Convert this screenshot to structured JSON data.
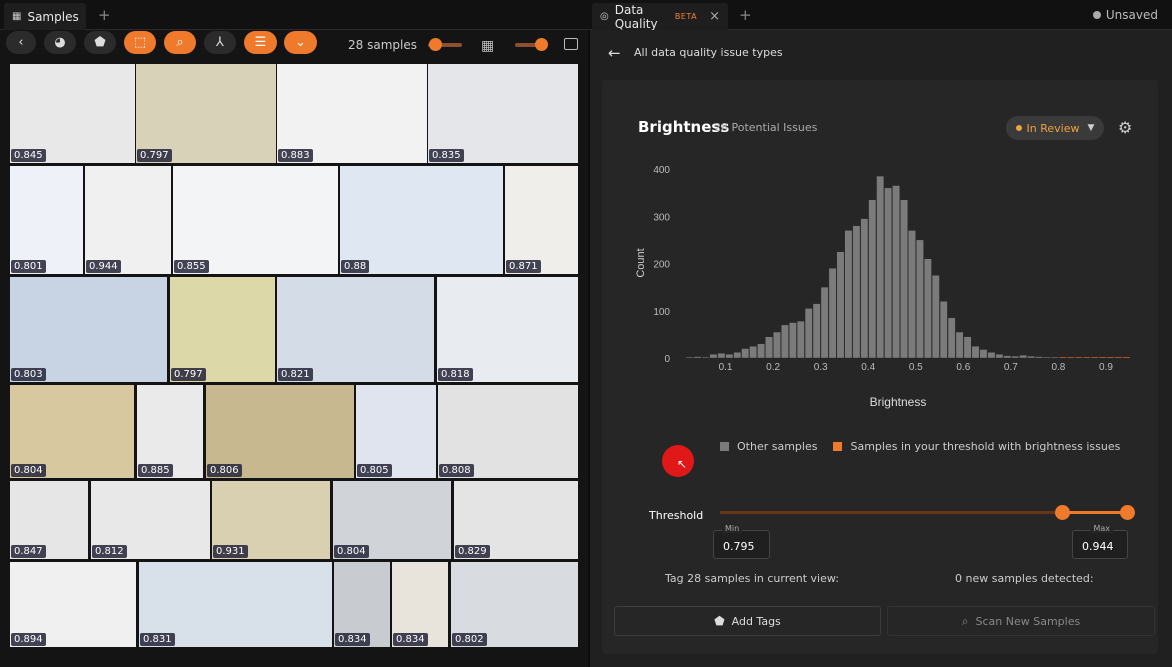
{
  "tabs": {
    "left_title": "Samples",
    "right_title": "Data Quality",
    "right_badge": "BETA",
    "plus": "+",
    "close": "×",
    "unsaved": "Unsaved"
  },
  "toolbar": {
    "sample_count": "28 samples",
    "zoom_level": 0.2,
    "size_level": 0.8,
    "icons": [
      "back-icon",
      "palette-icon",
      "tag-icon",
      "crop-icon",
      "search-icon",
      "merge-icon",
      "list-icon",
      "chevron-down-icon"
    ]
  },
  "samples": [
    {
      "score": "0.845"
    },
    {
      "score": "0.797"
    },
    {
      "score": "0.883"
    },
    {
      "score": "0.835"
    },
    {
      "score": "0.801"
    },
    {
      "score": "0.944"
    },
    {
      "score": "0.855"
    },
    {
      "score": "0.88"
    },
    {
      "score": "0.871"
    },
    {
      "score": "0.803"
    },
    {
      "score": "0.797"
    },
    {
      "score": "0.821"
    },
    {
      "score": "0.818"
    },
    {
      "score": "0.804"
    },
    {
      "score": "0.885"
    },
    {
      "score": "0.806"
    },
    {
      "score": "0.805"
    },
    {
      "score": "0.808"
    },
    {
      "score": "0.847"
    },
    {
      "score": "0.812"
    },
    {
      "score": "0.931"
    },
    {
      "score": "0.804"
    },
    {
      "score": "0.829"
    },
    {
      "score": "0.894"
    },
    {
      "score": "0.831"
    },
    {
      "score": "0.834"
    },
    {
      "score": "0.834"
    },
    {
      "score": "0.802"
    }
  ],
  "panel": {
    "back_label": "All data quality issue types",
    "title": "Brightness",
    "potential": "28 Potential Issues",
    "status": "In Review",
    "legend_other": "Other samples",
    "legend_threshold": "Samples in your threshold with brightness issues",
    "threshold_label": "Threshold",
    "min_label": "Min",
    "min_value": "0.795",
    "max_label": "Max",
    "max_value": "0.944",
    "tag_text": "Tag 28 samples in current view:",
    "new_text": "0 new samples detected:",
    "add_tags": "Add Tags",
    "scan_new": "Scan New Samples"
  },
  "chart_data": {
    "type": "bar",
    "xlabel": "Brightness",
    "ylabel": "Count",
    "xlim": [
      0,
      0.94
    ],
    "ylim": [
      0,
      400
    ],
    "xticks": [
      "0.1",
      "0.2",
      "0.3",
      "0.4",
      "0.5",
      "0.6",
      "0.7",
      "0.8",
      "0.9"
    ],
    "yticks": [
      "0",
      "100",
      "200",
      "300",
      "400"
    ],
    "bin_width": 0.0167,
    "bin_start": 0.0,
    "values": [
      0,
      2,
      3,
      2,
      8,
      10,
      8,
      12,
      20,
      25,
      30,
      45,
      55,
      70,
      75,
      78,
      105,
      115,
      150,
      190,
      225,
      270,
      280,
      295,
      335,
      385,
      360,
      365,
      335,
      270,
      250,
      210,
      175,
      120,
      85,
      55,
      45,
      25,
      18,
      12,
      8,
      5,
      4,
      6,
      4,
      3,
      2,
      2,
      1,
      2,
      1,
      1,
      1,
      1,
      1,
      1,
      1
    ],
    "threshold": [
      0.795,
      0.944
    ],
    "colors": {
      "other": "#7b7b7b",
      "threshold": "#f07a2c"
    }
  }
}
